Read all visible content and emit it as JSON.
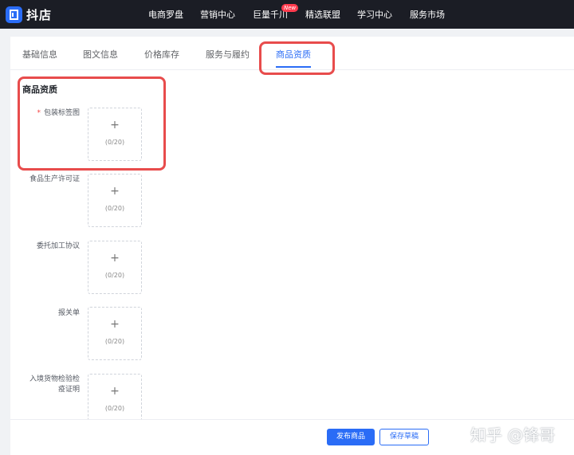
{
  "app": {
    "logo_text": "抖店"
  },
  "nav": {
    "items": [
      "电商罗盘",
      "营销中心",
      "巨量千川",
      "精选联盟",
      "学习中心",
      "服务市场"
    ],
    "new_badge": "New"
  },
  "tabs": [
    "基础信息",
    "图文信息",
    "价格库存",
    "服务与履约",
    "商品资质"
  ],
  "active_tab": "商品资质",
  "section": {
    "title": "商品资质",
    "fields": [
      {
        "label": "包装标签图",
        "required": true,
        "count": "(0/20)"
      },
      {
        "label": "食品生产许可证",
        "required": false,
        "count": "(0/20)"
      },
      {
        "label": "委托加工协议",
        "required": false,
        "count": "(0/20)"
      },
      {
        "label": "报关单",
        "required": false,
        "count": "(0/20)"
      },
      {
        "label_line1": "入境货物检验检",
        "label_line2": "疫证明",
        "required": false,
        "count": "(0/20)"
      }
    ],
    "required_mark": "*",
    "plus_glyph": "+"
  },
  "footer": {
    "publish_label": "发布商品",
    "save_draft_label": "保存草稿"
  },
  "watermark": "知乎 @锋哥",
  "colors": {
    "accent": "#2a6cf6",
    "highlight_border": "#e84c4c",
    "topbar": "#1b1d25",
    "required": "#f53f3f"
  }
}
